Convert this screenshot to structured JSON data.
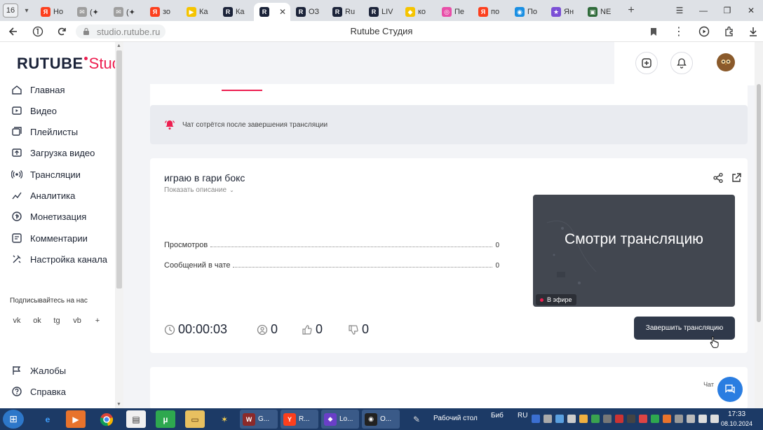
{
  "browser": {
    "tab_count": "16",
    "tabs": [
      {
        "label": "Но",
        "fav_color": "#fc3f1d",
        "fav_glyph": "Я"
      },
      {
        "label": "(✦",
        "fav_color": "#9e9e9e",
        "fav_glyph": "✉"
      },
      {
        "label": "(✦",
        "fav_color": "#9e9e9e",
        "fav_glyph": "✉"
      },
      {
        "label": "зо",
        "fav_color": "#fc3f1d",
        "fav_glyph": "Я"
      },
      {
        "label": "Ка",
        "fav_color": "#f5c400",
        "fav_glyph": "▶"
      },
      {
        "label": "Ка",
        "fav_color": "#1b2339",
        "fav_glyph": "R"
      },
      {
        "label": "",
        "fav_color": "#1b2339",
        "fav_glyph": "R",
        "active": true
      },
      {
        "label": "ОЗ",
        "fav_color": "#1b2339",
        "fav_glyph": "R"
      },
      {
        "label": "Ru",
        "fav_color": "#1b2339",
        "fav_glyph": "R"
      },
      {
        "label": "LIV",
        "fav_color": "#1b2339",
        "fav_glyph": "R"
      },
      {
        "label": "ко",
        "fav_color": "#f5c400",
        "fav_glyph": "◆"
      },
      {
        "label": "Пе",
        "fav_color": "#e84fa8",
        "fav_glyph": "◎"
      },
      {
        "label": "по",
        "fav_color": "#fc3f1d",
        "fav_glyph": "Я"
      },
      {
        "label": "По",
        "fav_color": "#1a8fe3",
        "fav_glyph": "◉"
      },
      {
        "label": "Ян",
        "fav_color": "#7b4fd6",
        "fav_glyph": "★"
      },
      {
        "label": "NE",
        "fav_color": "#2f6b3a",
        "fav_glyph": "▣"
      }
    ],
    "url": "studio.rutube.ru",
    "page_title": "Rutube Студия"
  },
  "logo": {
    "brand": "RUTUBE",
    "product": "Studio"
  },
  "nav": [
    {
      "label": "Главная",
      "icon": "home-icon"
    },
    {
      "label": "Видео",
      "icon": "video-icon"
    },
    {
      "label": "Плейлисты",
      "icon": "playlist-icon"
    },
    {
      "label": "Загрузка видео",
      "icon": "upload-icon"
    },
    {
      "label": "Трансляции",
      "icon": "broadcast-icon"
    },
    {
      "label": "Аналитика",
      "icon": "analytics-icon"
    },
    {
      "label": "Монетизация",
      "icon": "monetization-icon"
    },
    {
      "label": "Комментарии",
      "icon": "comments-icon"
    },
    {
      "label": "Настройка канала",
      "icon": "channel-settings-icon"
    }
  ],
  "follow_label": "Подписывайтесь на нас",
  "socials": [
    {
      "name": "vk-icon",
      "glyph": "vk"
    },
    {
      "name": "odnoklassniki-icon",
      "glyph": "ok"
    },
    {
      "name": "telegram-icon",
      "glyph": "tg"
    },
    {
      "name": "viber-icon",
      "glyph": "vb"
    },
    {
      "name": "more-icon",
      "glyph": "+"
    }
  ],
  "nav_bottom": [
    {
      "label": "Жалобы",
      "icon": "complaints-icon"
    },
    {
      "label": "Справка",
      "icon": "help-icon"
    }
  ],
  "notice": "Чат сотрётся после завершения трансляции",
  "stream": {
    "title": "играю в гари бокс",
    "desc_toggle": "Показать описание",
    "stats": [
      {
        "label": "Просмотров",
        "value": "0"
      },
      {
        "label": "Сообщений в чате",
        "value": "0"
      }
    ],
    "preview_text": "Смотри трансляцию",
    "live_badge": "В эфире",
    "duration": "00:00:03",
    "viewers": "0",
    "likes": "0",
    "dislikes": "0",
    "end_button": "Завершить трансляцию"
  },
  "chat_label": "Чат",
  "taskbar": {
    "apps": [
      {
        "label": "G...",
        "color": "#8b2a2a",
        "glyph": "W"
      },
      {
        "label": "R...",
        "color": "#fc3f1d",
        "glyph": "Y"
      },
      {
        "label": "Lo...",
        "color": "#6a3fc8",
        "glyph": "◆"
      },
      {
        "label": "O...",
        "color": "#222222",
        "glyph": "◉"
      }
    ],
    "desktop": "Рабочий стол",
    "library": "Биб",
    "lang": "RU",
    "time": "17:33",
    "date": "08.10.2024"
  },
  "colors": {
    "accent": "#ed1e50",
    "brand_dark": "#1b2339",
    "button_dark": "#30394a",
    "chat_fab": "#2a7de1"
  }
}
